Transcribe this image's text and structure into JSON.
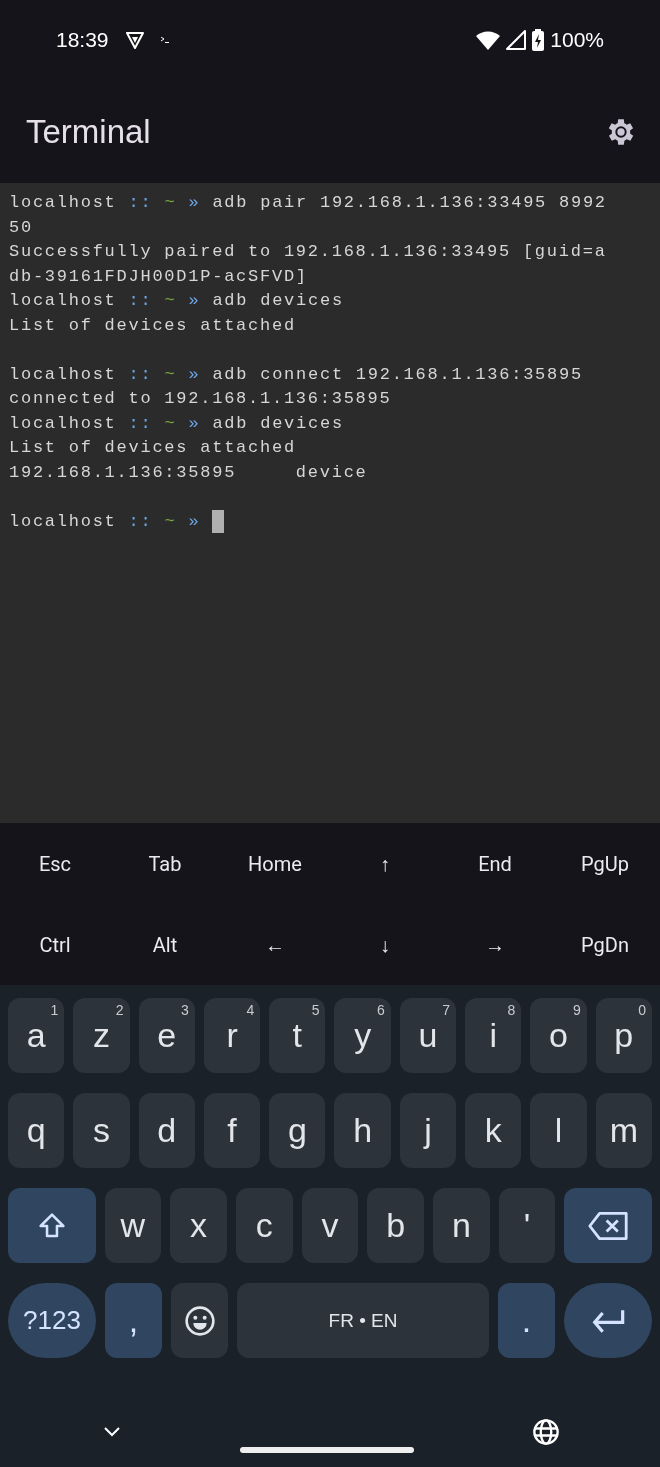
{
  "status_bar": {
    "time": "18:39",
    "battery": "100%"
  },
  "app_bar": {
    "title": "Terminal"
  },
  "terminal": {
    "lines": [
      {
        "kind": "prompt",
        "host": "localhost",
        "sep": "::",
        "dir": "~",
        "arrow": "»",
        "command": "adb pair 192.168.1.136:33495 8992"
      },
      {
        "kind": "output",
        "text": "50"
      },
      {
        "kind": "output",
        "text": "Successfully paired to 192.168.1.136:33495 [guid=a"
      },
      {
        "kind": "output",
        "text": "db-39161FDJH00D1P-acSFVD]"
      },
      {
        "kind": "prompt",
        "host": "localhost",
        "sep": "::",
        "dir": "~",
        "arrow": "»",
        "command": "adb devices"
      },
      {
        "kind": "output",
        "text": "List of devices attached"
      },
      {
        "kind": "blank"
      },
      {
        "kind": "prompt",
        "host": "localhost",
        "sep": "::",
        "dir": "~",
        "arrow": "»",
        "command": "adb connect 192.168.1.136:35895"
      },
      {
        "kind": "output",
        "text": "connected to 192.168.1.136:35895"
      },
      {
        "kind": "prompt",
        "host": "localhost",
        "sep": "::",
        "dir": "~",
        "arrow": "»",
        "command": "adb devices"
      },
      {
        "kind": "output",
        "text": "List of devices attached"
      },
      {
        "kind": "output",
        "text": "192.168.1.136:35895     device"
      },
      {
        "kind": "blank"
      },
      {
        "kind": "prompt",
        "host": "localhost",
        "sep": "::",
        "dir": "~",
        "arrow": "»",
        "cursor": true
      }
    ]
  },
  "extra_keys": [
    [
      "Esc",
      "Tab",
      "Home",
      "↑",
      "End",
      "PgUp"
    ],
    [
      "Ctrl",
      "Alt",
      "←",
      "↓",
      "→",
      "PgDn"
    ]
  ],
  "keyboard": {
    "rows": [
      [
        {
          "kind": "letter",
          "label": "a",
          "hint": "1"
        },
        {
          "kind": "letter",
          "label": "z",
          "hint": "2"
        },
        {
          "kind": "letter",
          "label": "e",
          "hint": "3"
        },
        {
          "kind": "letter",
          "label": "r",
          "hint": "4"
        },
        {
          "kind": "letter",
          "label": "t",
          "hint": "5"
        },
        {
          "kind": "letter",
          "label": "y",
          "hint": "6"
        },
        {
          "kind": "letter",
          "label": "u",
          "hint": "7"
        },
        {
          "kind": "letter",
          "label": "i",
          "hint": "8"
        },
        {
          "kind": "letter",
          "label": "o",
          "hint": "9"
        },
        {
          "kind": "letter",
          "label": "p",
          "hint": "0"
        }
      ],
      [
        {
          "kind": "letter",
          "label": "q"
        },
        {
          "kind": "letter",
          "label": "s"
        },
        {
          "kind": "letter",
          "label": "d"
        },
        {
          "kind": "letter",
          "label": "f"
        },
        {
          "kind": "letter",
          "label": "g"
        },
        {
          "kind": "letter",
          "label": "h"
        },
        {
          "kind": "letter",
          "label": "j"
        },
        {
          "kind": "letter",
          "label": "k"
        },
        {
          "kind": "letter",
          "label": "l"
        },
        {
          "kind": "letter",
          "label": "m"
        }
      ],
      [
        {
          "kind": "shift"
        },
        {
          "kind": "letter",
          "label": "w"
        },
        {
          "kind": "letter",
          "label": "x"
        },
        {
          "kind": "letter",
          "label": "c"
        },
        {
          "kind": "letter",
          "label": "v"
        },
        {
          "kind": "letter",
          "label": "b"
        },
        {
          "kind": "letter",
          "label": "n"
        },
        {
          "kind": "letter",
          "label": "'"
        },
        {
          "kind": "backspace"
        }
      ]
    ],
    "bottom_row": [
      {
        "kind": "symbols",
        "label": "?123"
      },
      {
        "kind": "accent",
        "label": ","
      },
      {
        "kind": "emoji"
      },
      {
        "kind": "space",
        "label": "FR • EN"
      },
      {
        "kind": "accent",
        "label": "."
      },
      {
        "kind": "enter"
      }
    ]
  }
}
